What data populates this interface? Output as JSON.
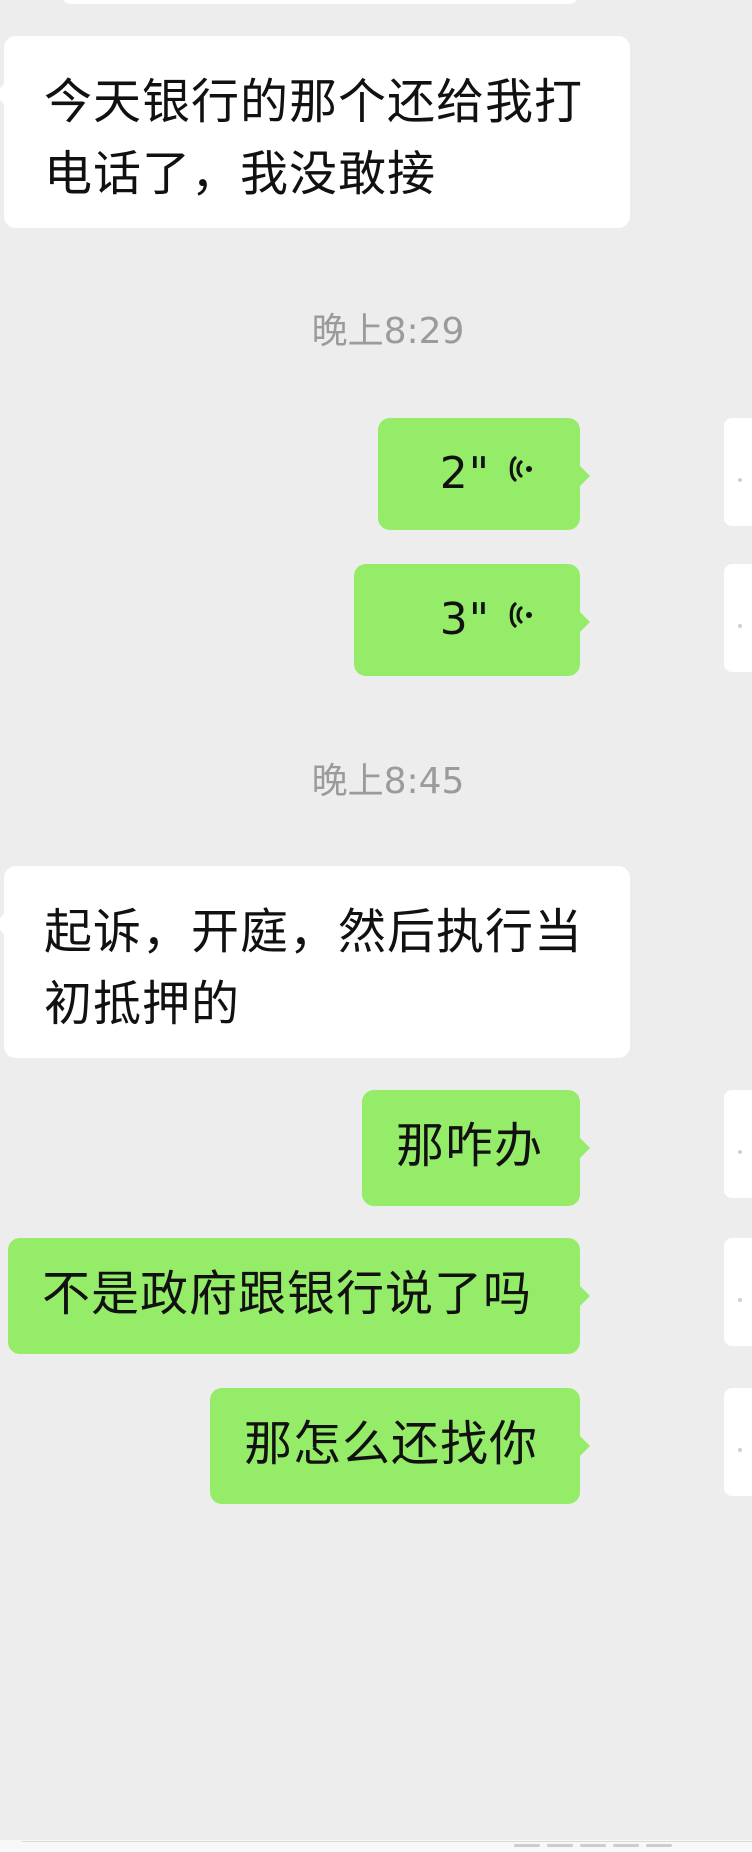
{
  "messages": {
    "incoming_1": "今天银行的那个还给我打电话了，我没敢接",
    "voice_1": "2\"",
    "voice_2": "3\"",
    "incoming_2": "起诉，开庭，然后执行当初抵押的",
    "outgoing_1": "那咋办",
    "outgoing_2": "不是政府跟银行说了吗",
    "outgoing_3": "那怎么还找你"
  },
  "timestamps": {
    "ts_1": "晚上8:29",
    "ts_2": "晚上8:45"
  },
  "colors": {
    "background": "#ededed",
    "incoming_bubble": "#ffffff",
    "outgoing_bubble": "#95ec69",
    "timestamp_text": "#9b9b9b",
    "message_text": "#111111"
  },
  "icons": {
    "voice": "voice-wave-icon"
  }
}
